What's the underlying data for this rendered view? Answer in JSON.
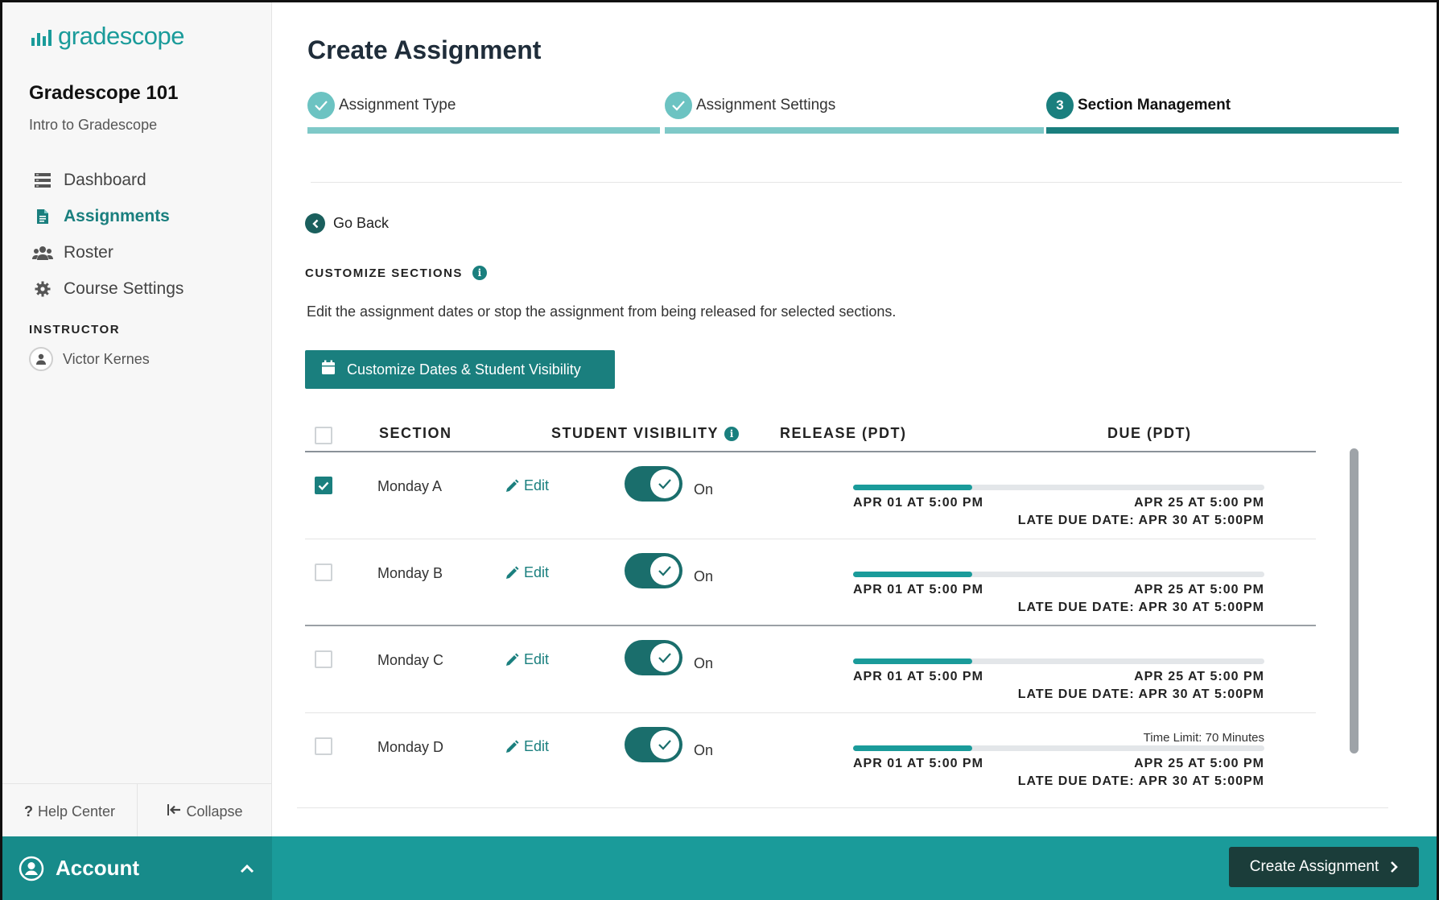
{
  "brand": {
    "name": "gradescope",
    "color": "#1a9b9a"
  },
  "course": {
    "title": "Gradescope 101",
    "subtitle": "Intro to Gradescope"
  },
  "nav": [
    {
      "label": "Dashboard",
      "icon": "dashboard-icon",
      "active": false
    },
    {
      "label": "Assignments",
      "icon": "document-icon",
      "active": true
    },
    {
      "label": "Roster",
      "icon": "people-icon",
      "active": false
    },
    {
      "label": "Course Settings",
      "icon": "gear-icon",
      "active": false
    }
  ],
  "instructor": {
    "heading": "INSTRUCTOR",
    "name": "Victor Kernes"
  },
  "sidebar_footer": {
    "help": "Help Center",
    "collapse": "Collapse"
  },
  "account": {
    "label": "Account"
  },
  "page": {
    "title": "Create Assignment"
  },
  "steps": [
    {
      "label": "Assignment Type",
      "state": "done"
    },
    {
      "label": "Assignment Settings",
      "state": "done"
    },
    {
      "number": "3",
      "label": "Section Management",
      "state": "current"
    }
  ],
  "go_back": "Go Back",
  "customize": {
    "heading": "CUSTOMIZE SECTIONS",
    "description": "Edit the assignment dates or stop the assignment from being released for selected sections.",
    "button": "Customize Dates & Student Visibility"
  },
  "table": {
    "headers": {
      "section": "SECTION",
      "visibility": "STUDENT VISIBILITY",
      "release": "RELEASE (PDT)",
      "due": "DUE (PDT)"
    },
    "rows": [
      {
        "name": "Monday A",
        "checked": true,
        "edit": "Edit",
        "visibility": "On",
        "release": "APR 01 AT 5:00 PM",
        "due": "APR 25 AT 5:00 PM",
        "late": "LATE DUE DATE: APR 30 AT 5:00PM",
        "time_limit": "",
        "progress": 0.29
      },
      {
        "name": "Monday B",
        "checked": false,
        "edit": "Edit",
        "visibility": "On",
        "release": "APR 01 AT 5:00 PM",
        "due": "APR 25 AT 5:00 PM",
        "late": "LATE DUE DATE: APR 30 AT 5:00PM",
        "time_limit": "",
        "progress": 0.29
      },
      {
        "name": "Monday C",
        "checked": false,
        "edit": "Edit",
        "visibility": "On",
        "release": "APR 01 AT 5:00 PM",
        "due": "APR 25 AT 5:00 PM",
        "late": "LATE DUE DATE: APR 30 AT 5:00PM",
        "time_limit": "",
        "progress": 0.29
      },
      {
        "name": "Monday D",
        "checked": false,
        "edit": "Edit",
        "visibility": "On",
        "release": "APR 01 AT 5:00 PM",
        "due": "APR 25 AT 5:00 PM",
        "late": "LATE DUE DATE: APR 30 AT 5:00PM",
        "time_limit": "Time Limit: 70 Minutes",
        "progress": 0.29
      }
    ]
  },
  "footer_button": "Create Assignment",
  "colors": {
    "accent": "#1a7f7e",
    "teal": "#1a9b9a",
    "dark_button": "#1b3d3a"
  }
}
